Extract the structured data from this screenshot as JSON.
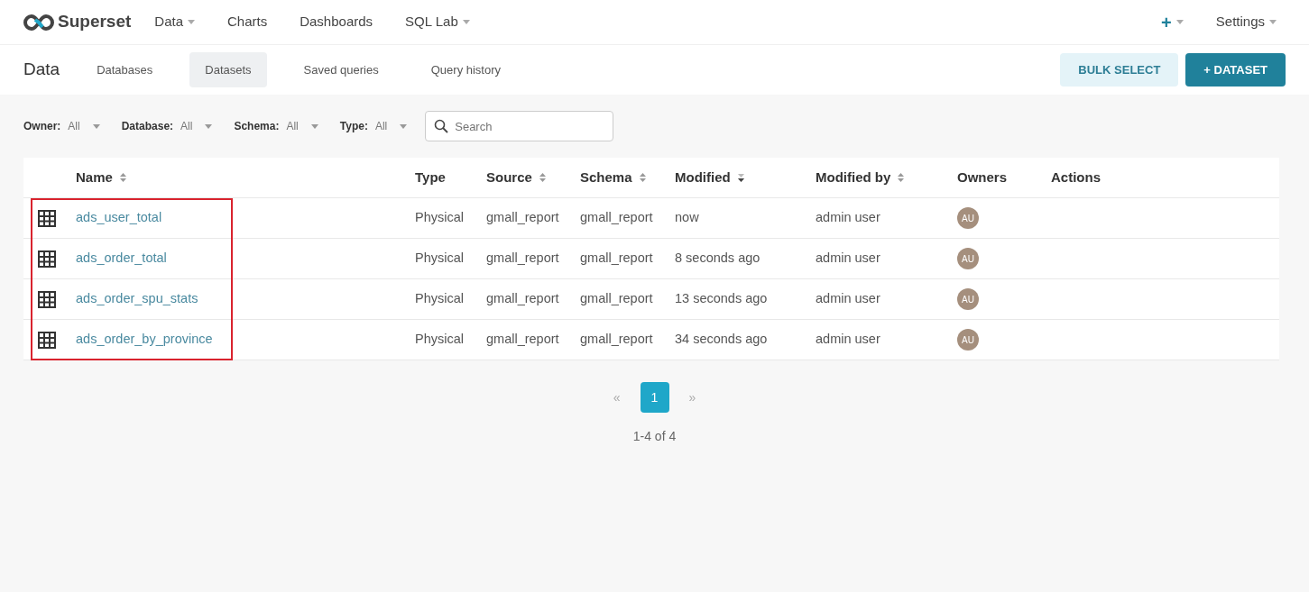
{
  "brand": {
    "name": "Superset"
  },
  "nav": [
    {
      "label": "Data",
      "dropdown": true
    },
    {
      "label": "Charts",
      "dropdown": false
    },
    {
      "label": "Dashboards",
      "dropdown": false
    },
    {
      "label": "SQL Lab",
      "dropdown": true
    }
  ],
  "nav_right": [
    {
      "kind": "plus",
      "label": "+",
      "dropdown": true
    },
    {
      "kind": "text",
      "label": "Settings",
      "dropdown": true
    }
  ],
  "subheader": {
    "title": "Data",
    "tabs": [
      {
        "label": "Databases",
        "selected": false
      },
      {
        "label": "Datasets",
        "selected": true
      },
      {
        "label": "Saved queries",
        "selected": false
      },
      {
        "label": "Query history",
        "selected": false
      }
    ],
    "buttons": [
      {
        "kind": "secondary",
        "label": "BULK SELECT"
      },
      {
        "kind": "primary",
        "icon": "+",
        "label": "DATASET"
      }
    ]
  },
  "filters": [
    {
      "label": "Owner:",
      "value": "All"
    },
    {
      "label": "Database:",
      "value": "All"
    },
    {
      "label": "Schema:",
      "value": "All"
    },
    {
      "label": "Type:",
      "value": "All"
    }
  ],
  "search": {
    "placeholder": "Search"
  },
  "table": {
    "columns": [
      {
        "label": "Name",
        "sortable": true,
        "sorted_descending": false
      },
      {
        "label": "Type",
        "sortable": false
      },
      {
        "label": "Source",
        "sortable": true,
        "sorted_descending": false
      },
      {
        "label": "Schema",
        "sortable": true,
        "sorted_descending": false
      },
      {
        "label": "Modified",
        "sortable": true,
        "sorted_descending": true
      },
      {
        "label": "Modified by",
        "sortable": true,
        "sorted_descending": false
      },
      {
        "label": "Owners",
        "sortable": false
      },
      {
        "label": "Actions",
        "sortable": false
      }
    ],
    "rows": [
      {
        "name": "ads_user_total",
        "type": "Physical",
        "source": "gmall_report",
        "schema": "gmall_report",
        "modified": "now",
        "modified_by": "admin user",
        "owner": "AU",
        "highlighted": true
      },
      {
        "name": "ads_order_total",
        "type": "Physical",
        "source": "gmall_report",
        "schema": "gmall_report",
        "modified": "8 seconds ago",
        "modified_by": "admin user",
        "owner": "AU",
        "highlighted": true
      },
      {
        "name": "ads_order_spu_stats",
        "type": "Physical",
        "source": "gmall_report",
        "schema": "gmall_report",
        "modified": "13 seconds ago",
        "modified_by": "admin user",
        "owner": "AU",
        "highlighted": true
      },
      {
        "name": "ads_order_by_province",
        "type": "Physical",
        "source": "gmall_report",
        "schema": "gmall_report",
        "modified": "34 seconds ago",
        "modified_by": "admin user",
        "owner": "AU",
        "highlighted": true
      }
    ]
  },
  "pagination": {
    "prev": "«",
    "pages": [
      {
        "label": "1",
        "selected": true
      }
    ],
    "next": "»",
    "summary": "1-4 of 4"
  }
}
